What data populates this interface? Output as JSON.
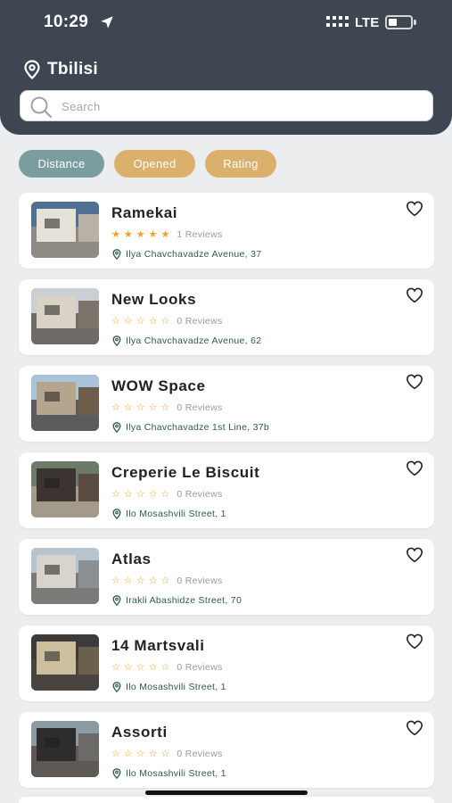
{
  "status_bar": {
    "time": "10:29",
    "network": "LTE",
    "battery_level": 0.4
  },
  "location": {
    "city": "Tbilisi"
  },
  "search": {
    "placeholder": "Search",
    "value": ""
  },
  "filters": [
    {
      "label": "Distance",
      "color": "#7a9e9f"
    },
    {
      "label": "Opened",
      "color": "#dbb06d"
    },
    {
      "label": "Rating",
      "color": "#dbb06d"
    }
  ],
  "places": [
    {
      "name": "Ramekai",
      "rating": 5,
      "reviews": "1 Reviews",
      "address": "Ilya Chavchavadze Avenue, 37"
    },
    {
      "name": "New Looks",
      "rating": 0,
      "reviews": "0 Reviews",
      "address": "Ilya Chavchavadze Avenue, 62"
    },
    {
      "name": "WOW Space",
      "rating": 0,
      "reviews": "0 Reviews",
      "address": "Ilya Chavchavadze 1st Line, 37b"
    },
    {
      "name": "Creperie Le Biscuit",
      "rating": 0,
      "reviews": "0 Reviews",
      "address": "Ilo Mosashvili Street, 1"
    },
    {
      "name": "Atlas",
      "rating": 0,
      "reviews": "0 Reviews",
      "address": "Irakli Abashidze Street, 70"
    },
    {
      "name": "14 Martsvali",
      "rating": 0,
      "reviews": "0 Reviews",
      "address": "Ilo Mosashvili Street, 1"
    },
    {
      "name": "Assorti",
      "rating": 0,
      "reviews": "0 Reviews",
      "address": "Ilo Mosashvili Street, 1"
    }
  ],
  "icons": {
    "location_arrow": "location-arrow-icon",
    "pin": "map-pin-icon",
    "search": "search-icon",
    "heart": "heart-outline-icon",
    "star": "star-icon"
  },
  "colors": {
    "header": "#3e4652",
    "star": "#f2a023",
    "address_text": "#2e5a4e",
    "background": "#ecedee"
  }
}
